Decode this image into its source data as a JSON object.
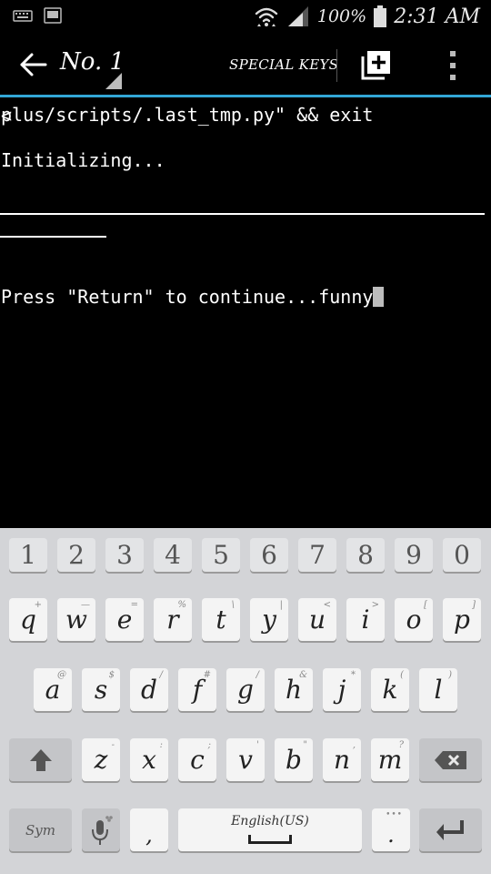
{
  "status_bar": {
    "battery": "100%",
    "time": "2:31 AM"
  },
  "action_bar": {
    "title": "No. 1",
    "special_keys": "SPECIAL KEYS"
  },
  "terminal": {
    "lines": [
      "plus/scripts/.last_tmp.py\" && exit",
      "Initializing...",
      "Press \"Return\" to continue...funny"
    ],
    "scroll_indicator": "<"
  },
  "keyboard": {
    "numbers": [
      "1",
      "2",
      "3",
      "4",
      "5",
      "6",
      "7",
      "8",
      "9",
      "0"
    ],
    "row1": [
      {
        "k": "q",
        "h": "+"
      },
      {
        "k": "w",
        "h": "—"
      },
      {
        "k": "e",
        "h": "="
      },
      {
        "k": "r",
        "h": "%"
      },
      {
        "k": "t",
        "h": "\\"
      },
      {
        "k": "y",
        "h": "|"
      },
      {
        "k": "u",
        "h": "<"
      },
      {
        "k": "i",
        "h": ">"
      },
      {
        "k": "o",
        "h": "["
      },
      {
        "k": "p",
        "h": "]"
      }
    ],
    "row2": [
      {
        "k": "a",
        "h": "@"
      },
      {
        "k": "s",
        "h": "$"
      },
      {
        "k": "d",
        "h": "/"
      },
      {
        "k": "f",
        "h": "#"
      },
      {
        "k": "g",
        "h": "/"
      },
      {
        "k": "h",
        "h": "&"
      },
      {
        "k": "j",
        "h": "*"
      },
      {
        "k": "k",
        "h": "("
      },
      {
        "k": "l",
        "h": ")"
      }
    ],
    "row3": [
      {
        "k": "z",
        "h": "-"
      },
      {
        "k": "x",
        "h": ":"
      },
      {
        "k": "c",
        "h": ";"
      },
      {
        "k": "v",
        "h": "'"
      },
      {
        "k": "b",
        "h": "\""
      },
      {
        "k": "n",
        "h": ","
      },
      {
        "k": "m",
        "h": "?"
      }
    ],
    "sym_label": "Sym",
    "comma": ",",
    "space_label": "English(US)",
    "period": ".",
    "period_hint": "•••"
  }
}
